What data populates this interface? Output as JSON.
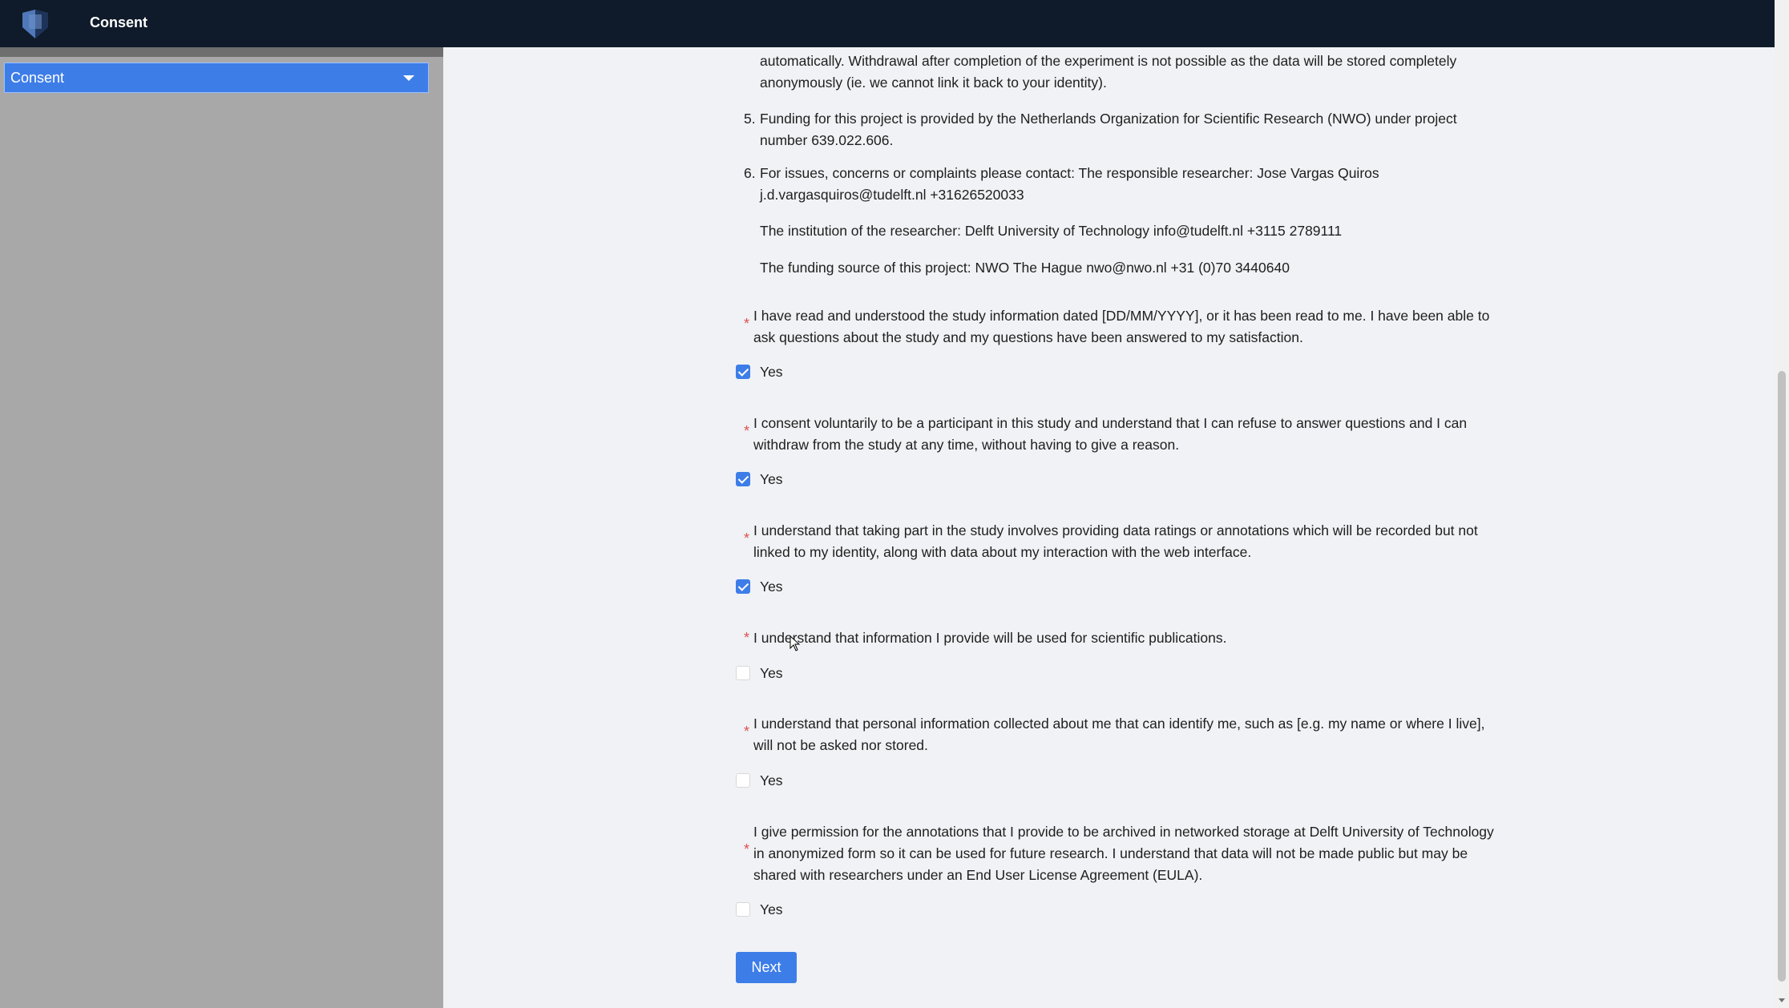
{
  "header": {
    "title": "Consent",
    "logo_icon": "shield-logo-icon"
  },
  "sidebar": {
    "section_select": {
      "value": "Consent"
    }
  },
  "info": {
    "item4_tail": "automatically. Withdrawal after completion of the experiment is not possible as the data will be stored completely anonymously (ie. we cannot link it back to your identity).",
    "item5": {
      "num": "5.",
      "text": "Funding for this project is provided by the Netherlands Organization for Scientific Research (NWO) under project number 639.022.606."
    },
    "item6": {
      "num": "6.",
      "text": "For issues, concerns or complaints please contact: The responsible researcher: Jose Vargas Quiros j.d.vargasquiros@tudelft.nl +31626520033",
      "institution": "The institution of the researcher: Delft University of Technology info@tudelft.nl +3115 2789111",
      "funding": "The funding source of this project: NWO The Hague nwo@nwo.nl +31 (0)70 3440640"
    }
  },
  "questions": [
    {
      "required_mark": "*",
      "text": "I have read and understood the study information dated [DD/MM/YYYY], or it has been read to me. I have been able to ask questions about the study and my questions have been answered to my satisfaction.",
      "option": "Yes",
      "checked": true
    },
    {
      "required_mark": "*",
      "text": "I consent voluntarily to be a participant in this study and understand that I can refuse to answer questions and I can withdraw from the study at any time, without having to give a reason.",
      "option": "Yes",
      "checked": true
    },
    {
      "required_mark": "*",
      "text": "I understand that taking part in the study involves providing data ratings or annotations which will be recorded but not linked to my identity, along with data about my interaction with the web interface.",
      "option": "Yes",
      "checked": true
    },
    {
      "required_mark": "*",
      "text": "I understand that information I provide will be used for scientific publications.",
      "option": "Yes",
      "checked": false
    },
    {
      "required_mark": "*",
      "text": "I understand that personal information collected about me that can identify me, such as [e.g. my name or where I live], will not be asked nor stored.",
      "option": "Yes",
      "checked": false
    },
    {
      "required_mark": "*",
      "text": "I give permission for the annotations that I provide to be archived in networked storage at Delft University of Technology in anonymized form so it can be used for future research. I understand that data will not be made public but may be shared with researchers under an End User License Agreement (EULA).",
      "option": "Yes",
      "checked": false
    }
  ],
  "actions": {
    "next_label": "Next"
  },
  "colors": {
    "accent": "#3d7de8",
    "topbar": "#0f1b2a",
    "sidebar": "#a8a8a8",
    "required": "#e05050"
  }
}
